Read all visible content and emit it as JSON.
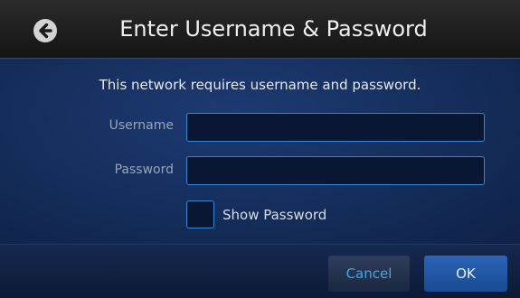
{
  "header": {
    "title": "Enter Username & Password",
    "back_icon": "back-arrow-icon"
  },
  "form": {
    "message": "This network requires username and password.",
    "username_label": "Username",
    "username_value": "",
    "password_label": "Password",
    "password_value": "",
    "show_password_label": "Show Password",
    "show_password_checked": false
  },
  "footer": {
    "cancel_label": "Cancel",
    "ok_label": "OK"
  },
  "colors": {
    "accent": "#2f86d6",
    "background": "#16305f",
    "header": "#1e1e1e",
    "ok_button": "#1f56a6",
    "cancel_text": "#43a5e8"
  }
}
